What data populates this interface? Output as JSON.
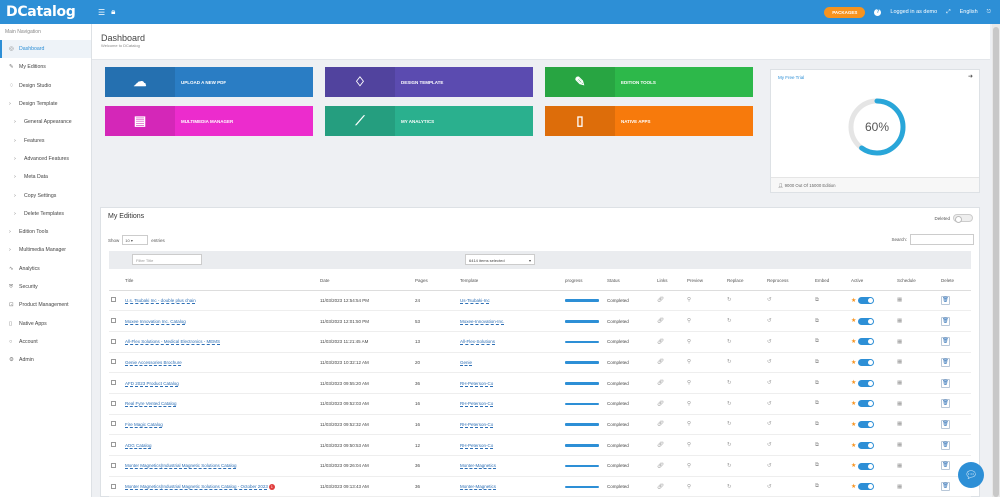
{
  "topbar": {
    "logo": "DCatalog",
    "packages_label": "PACKAGES",
    "help_icon": "?",
    "user_label": "Logged in as demo",
    "language": "English"
  },
  "sidebar": {
    "heading": "Main Navigation",
    "items": [
      {
        "label": "Dashboard",
        "icon": "dashboard-icon",
        "active": true
      },
      {
        "label": "My Editions",
        "icon": "pencil-icon"
      },
      {
        "label": "Design Studio",
        "icon": "lightbulb-icon"
      },
      {
        "label": "Design Template",
        "icon": "chevron-icon"
      },
      {
        "label": "General Appearance",
        "sub": true
      },
      {
        "label": "Features",
        "sub": true
      },
      {
        "label": "Advanced Features",
        "sub": true
      },
      {
        "label": "Meta Data",
        "sub": true
      },
      {
        "label": "Copy Settings",
        "sub": true
      },
      {
        "label": "Delete Templates",
        "sub": true
      },
      {
        "label": "Edition Tools",
        "icon": "chevron-icon"
      },
      {
        "label": "Multimedia Manager",
        "icon": "chevron-icon"
      },
      {
        "label": "Analytics",
        "icon": "chart-icon"
      },
      {
        "label": "Security",
        "icon": "shield-icon"
      },
      {
        "label": "Product Management",
        "icon": "cart-icon"
      },
      {
        "label": "Native Apps",
        "icon": "phone-icon"
      },
      {
        "label": "Account",
        "icon": "user-icon"
      },
      {
        "label": "Admin",
        "icon": "gear-icon"
      }
    ]
  },
  "dashboard": {
    "title": "Dashboard",
    "subtitle": "Welcome to DCatalog"
  },
  "tiles": [
    {
      "label": "UPLOAD A NEW PDF",
      "icon": "cloud-upload-icon",
      "color": "#2a7dc4"
    },
    {
      "label": "DESIGN TEMPLATE",
      "icon": "lightbulb-icon",
      "color": "#5b4bb0"
    },
    {
      "label": "EDITION TOOLS",
      "icon": "pencil-icon",
      "color": "#2db84a"
    },
    {
      "label": "MULTIMEDIA MANAGER",
      "icon": "film-icon",
      "color": "#ec2ccd"
    },
    {
      "label": "MY ANALYTICS",
      "icon": "trend-icon",
      "color": "#2ab08e"
    },
    {
      "label": "NATIVE APPS",
      "icon": "phone-icon",
      "color": "#f77a0c"
    }
  ],
  "trial": {
    "title": "My Free Trial",
    "percent_label": "60%",
    "percent": 60,
    "footer": "9000 Out Of 15000 Edition"
  },
  "editions": {
    "title": "My Editions",
    "deleted_label": "Deleted",
    "show_label": "Show",
    "entries_select": "10",
    "entries_label": "entries",
    "search_label": "Search:",
    "filter_title_placeholder": "Filter Title",
    "template_filter": "6414 items selected",
    "columns": [
      "",
      "Title",
      "Date",
      "Pages",
      "Template",
      "progress",
      "Status",
      "Links",
      "Preview",
      "Replace",
      "Reprocess",
      "Embed",
      "Active",
      "Schedule",
      "Delete"
    ],
    "rows": [
      {
        "title": "U.s. Tsubaki Inc - double plus chain",
        "date": "11/03/2023 12:54:54 PM",
        "pages": "24",
        "template": "Us-Tsubaki-Inc",
        "status": "Completed"
      },
      {
        "title": "Moxee Innovation Inc. Catalog",
        "date": "11/03/2023 12:01:50 PM",
        "pages": "53",
        "template": "Moxee-Innovation-Inc.",
        "status": "Completed"
      },
      {
        "title": "All-Flex Solutions - Medical Electronics - MEMS",
        "date": "11/03/2023 11:21:45 AM",
        "pages": "13",
        "template": "All-Flex-Solutions",
        "status": "Completed"
      },
      {
        "title": "Genie Accessories Brochure",
        "date": "11/03/2023 10:32:12 AM",
        "pages": "20",
        "template": "Genie",
        "status": "Completed"
      },
      {
        "title": "AFD 2023 Product Catalog",
        "date": "11/03/2023 09:55:20 AM",
        "pages": "36",
        "template": "RH-Peterson-Co",
        "status": "Completed"
      },
      {
        "title": "Real Fyre Vented Catalog",
        "date": "11/03/2023 09:52:03 AM",
        "pages": "16",
        "template": "RH-Peterson-Co",
        "status": "Completed"
      },
      {
        "title": "Fire Magic Catalog",
        "date": "11/03/2023 09:52:32 AM",
        "pages": "16",
        "template": "RH-Peterson-Co",
        "status": "Completed"
      },
      {
        "title": "ADG Catalog",
        "date": "11/03/2023 09:50:53 AM",
        "pages": "12",
        "template": "RH-Peterson-Co",
        "status": "Completed"
      },
      {
        "title": "Monter Magnetics(Industrial Magnetic Solutions Catalog",
        "date": "11/03/2023 09:26:04 AM",
        "pages": "36",
        "template": "Monter-Magnetics",
        "status": "Completed"
      },
      {
        "title": "Monter Magnetics(Industrial Magnetic Solutions Catalog - October 2023",
        "date": "11/03/2023 09:13:43 AM",
        "pages": "36",
        "template": "Monter-Magnetics",
        "status": "Completed",
        "badge": "1"
      }
    ]
  }
}
